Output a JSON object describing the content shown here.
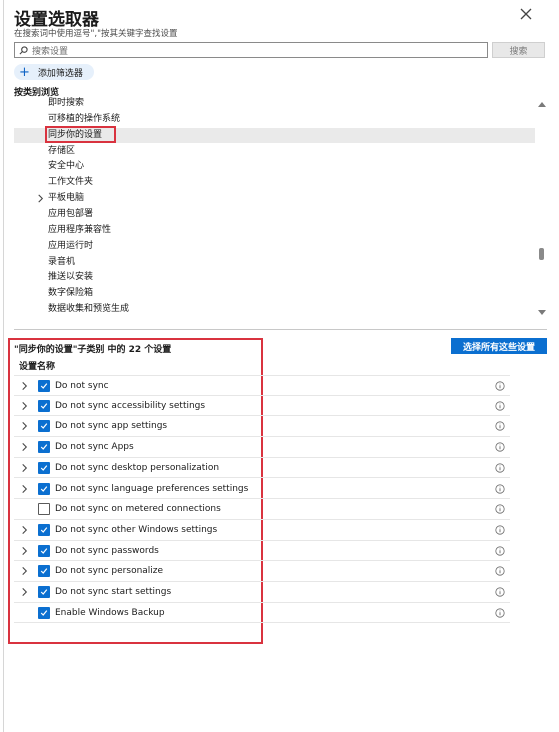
{
  "title": "设置选取器",
  "subtitle": "在搜索词中使用逗号\",\"按其关键字查找设置",
  "search": {
    "placeholder": "搜索设置",
    "button_label": "搜索"
  },
  "add_filter_label": "添加筛选器",
  "browse_label": "按类别浏览",
  "categories": [
    {
      "label": "即时搜索",
      "expandable": false,
      "selected": false
    },
    {
      "label": "可移植的操作系统",
      "expandable": false,
      "selected": false
    },
    {
      "label": "同步你的设置",
      "expandable": false,
      "selected": true
    },
    {
      "label": "存储区",
      "expandable": false,
      "selected": false
    },
    {
      "label": "安全中心",
      "expandable": false,
      "selected": false
    },
    {
      "label": "工作文件夹",
      "expandable": false,
      "selected": false
    },
    {
      "label": "平板电脑",
      "expandable": true,
      "selected": false
    },
    {
      "label": "应用包部署",
      "expandable": false,
      "selected": false
    },
    {
      "label": "应用程序兼容性",
      "expandable": false,
      "selected": false
    },
    {
      "label": "应用运行时",
      "expandable": false,
      "selected": false
    },
    {
      "label": "录音机",
      "expandable": false,
      "selected": false
    },
    {
      "label": "推送以安装",
      "expandable": false,
      "selected": false
    },
    {
      "label": "数字保险箱",
      "expandable": false,
      "selected": false
    },
    {
      "label": "数据收集和预览生成",
      "expandable": false,
      "selected": false
    }
  ],
  "settings_count_label": "\"同步你的设置\"子类别 中的 22 个设置",
  "select_all_label": "选择所有这些设置",
  "column_header": "设置名称",
  "settings": [
    {
      "label": "Do not sync",
      "checked": true,
      "expandable": true
    },
    {
      "label": "Do not sync accessibility settings",
      "checked": true,
      "expandable": true
    },
    {
      "label": "Do not sync app settings",
      "checked": true,
      "expandable": true
    },
    {
      "label": "Do not sync Apps",
      "checked": true,
      "expandable": true
    },
    {
      "label": "Do not sync desktop personalization",
      "checked": true,
      "expandable": true
    },
    {
      "label": "Do not sync language preferences settings",
      "checked": true,
      "expandable": true
    },
    {
      "label": "Do not sync on metered connections",
      "checked": false,
      "expandable": false
    },
    {
      "label": "Do not sync other Windows settings",
      "checked": true,
      "expandable": true
    },
    {
      "label": "Do not sync passwords",
      "checked": true,
      "expandable": true
    },
    {
      "label": "Do not sync personalize",
      "checked": true,
      "expandable": true
    },
    {
      "label": "Do not sync start settings",
      "checked": true,
      "expandable": true
    },
    {
      "label": "Enable Windows Backup",
      "checked": true,
      "expandable": false
    }
  ],
  "colors": {
    "accent": "#0b6fd0",
    "highlight": "#d9333f",
    "selected_bg": "#eaeaea"
  }
}
